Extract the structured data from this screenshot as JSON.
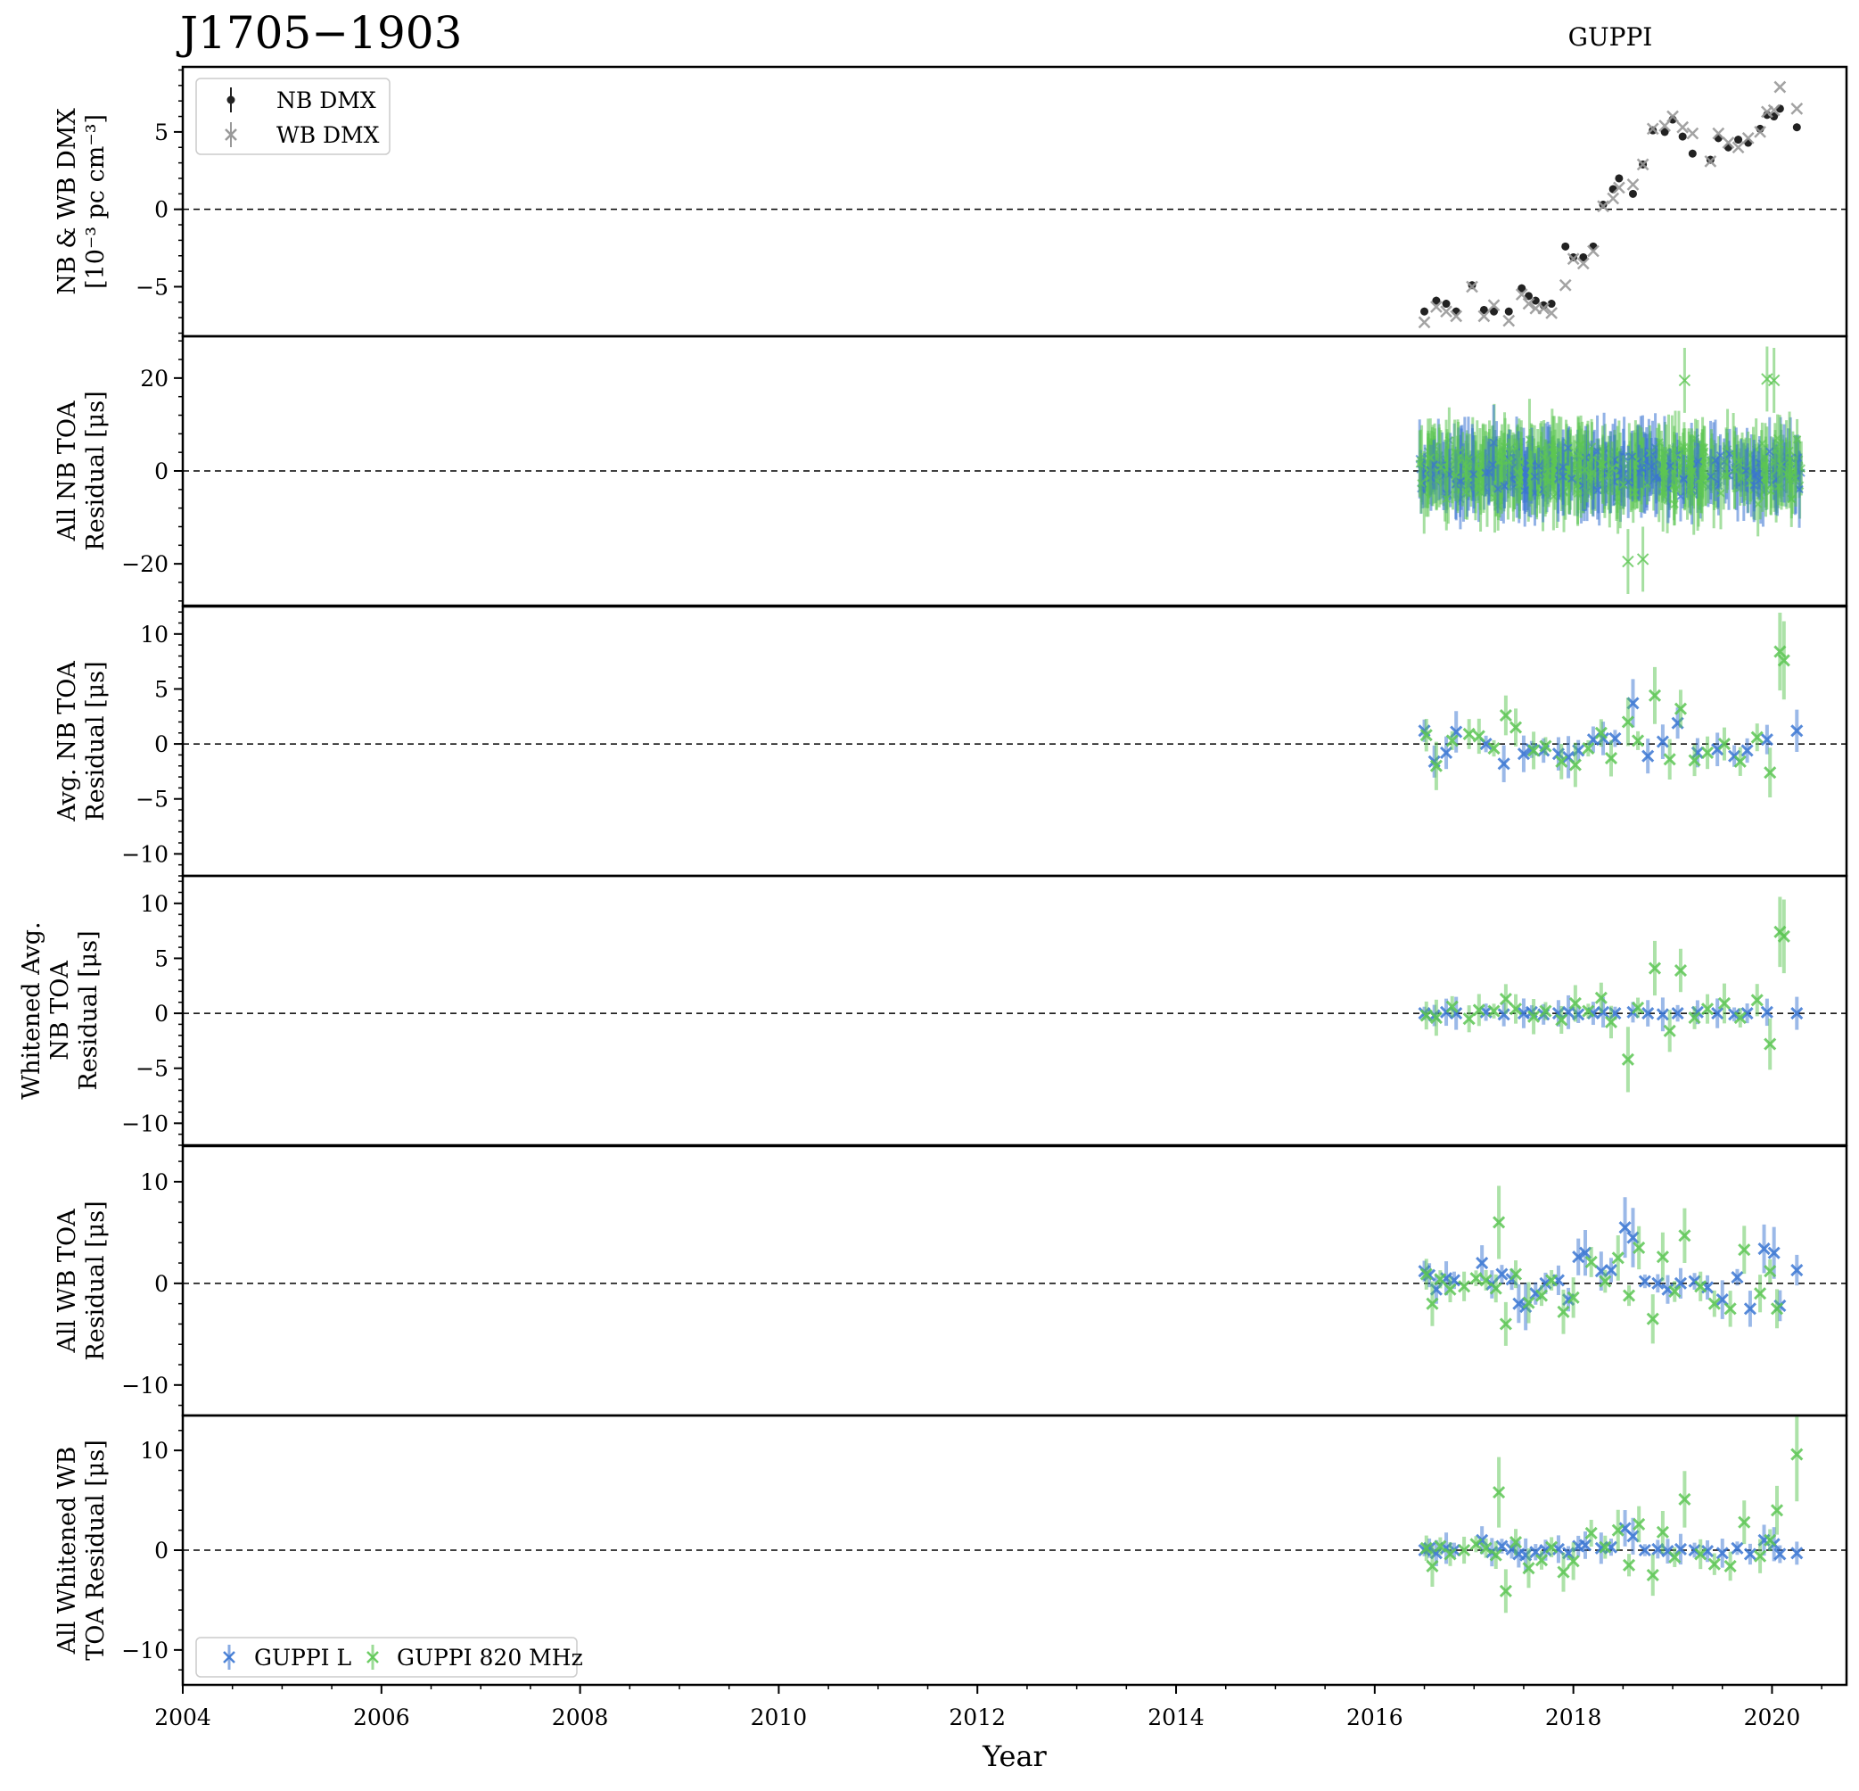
{
  "title": "J1705−1903",
  "subtitle": "GUPPI",
  "colors": {
    "nb_dmx": "#222222",
    "wb_dmx": "#999999",
    "guppi_l": "#3a75d2",
    "guppi_820": "#5cc653"
  },
  "chart_data": {
    "type": "scatter",
    "xlabel": "Year",
    "xlim": [
      2004,
      2020.75
    ],
    "xticks": [
      "2004",
      "2006",
      "2008",
      "2010",
      "2012",
      "2014",
      "2016",
      "2018",
      "2020"
    ],
    "panels": [
      {
        "id": "dmx",
        "ylabel_lines": [
          "NB & WB DMX",
          "[10⁻³ pc cm⁻³]"
        ],
        "ylim": [
          -8.2,
          9.2
        ],
        "yticks": [
          "−5",
          "0",
          "5"
        ],
        "ytick_values": [
          -5,
          0,
          5
        ],
        "legend": {
          "position": "top-left",
          "entries": [
            "NB DMX",
            "WB DMX"
          ]
        },
        "series": [
          {
            "name": "NB DMX",
            "marker": "dot",
            "color": "#222222",
            "x": [
              2016.5,
              2016.62,
              2016.72,
              2016.82,
              2016.98,
              2017.1,
              2017.2,
              2017.35,
              2017.48,
              2017.55,
              2017.62,
              2017.7,
              2017.78,
              2017.92,
              2018.0,
              2018.1,
              2018.2,
              2018.3,
              2018.4,
              2018.46,
              2018.6,
              2018.7,
              2018.8,
              2018.92,
              2019.0,
              2019.1,
              2019.2,
              2019.38,
              2019.46,
              2019.56,
              2019.66,
              2019.76,
              2019.88,
              2019.95,
              2020.02,
              2020.08,
              2020.25
            ],
            "y": [
              -6.6,
              -5.9,
              -6.1,
              -6.6,
              -4.9,
              -6.5,
              -6.6,
              -6.6,
              -5.1,
              -5.6,
              -5.9,
              -6.2,
              -6.1,
              -2.4,
              -3.1,
              -3.1,
              -2.4,
              0.3,
              1.3,
              2.0,
              1.0,
              2.9,
              5.1,
              5.0,
              5.8,
              4.7,
              3.6,
              3.2,
              4.6,
              4.0,
              4.5,
              4.3,
              5.2,
              6.1,
              6.0,
              6.5,
              5.3
            ]
          },
          {
            "name": "WB DMX",
            "marker": "x",
            "color": "#999999",
            "x": [
              2016.5,
              2016.62,
              2016.72,
              2016.82,
              2016.98,
              2017.1,
              2017.2,
              2017.35,
              2017.48,
              2017.55,
              2017.62,
              2017.7,
              2017.78,
              2017.92,
              2018.0,
              2018.1,
              2018.2,
              2018.3,
              2018.4,
              2018.46,
              2018.6,
              2018.7,
              2018.8,
              2018.92,
              2019.0,
              2019.1,
              2019.2,
              2019.38,
              2019.46,
              2019.56,
              2019.66,
              2019.76,
              2019.88,
              2019.95,
              2020.02,
              2020.08,
              2020.25
            ],
            "y": [
              -7.3,
              -6.3,
              -6.6,
              -6.9,
              -5.0,
              -6.9,
              -6.2,
              -7.2,
              -5.5,
              -6.1,
              -6.4,
              -6.4,
              -6.7,
              -4.9,
              -3.2,
              -3.5,
              -2.7,
              0.2,
              0.7,
              1.4,
              1.6,
              2.9,
              5.2,
              5.4,
              6.0,
              5.3,
              4.9,
              3.1,
              4.9,
              4.3,
              4.0,
              4.6,
              5.0,
              6.3,
              6.4,
              7.9,
              6.5
            ]
          }
        ]
      },
      {
        "id": "all_nb",
        "ylabel_lines": [
          "All NB TOA",
          "Residual [μs]"
        ],
        "ylim": [
          -29,
          29
        ],
        "yticks": [
          "−20",
          "0",
          "20"
        ],
        "ytick_values": [
          -20,
          0,
          20
        ],
        "cluster": {
          "x_start": 2016.45,
          "x_end": 2020.3,
          "spread": 5,
          "err": 6,
          "extremes": [
            [
              2018.55,
              -19.5
            ],
            [
              2019.12,
              19.5
            ],
            [
              2019.95,
              19.8
            ],
            [
              2020.02,
              19.5
            ],
            [
              2018.7,
              -19.0
            ]
          ]
        }
      },
      {
        "id": "avg_nb",
        "ylabel_lines": [
          "Avg. NB TOA",
          "Residual [μs]"
        ],
        "ylim": [
          -12,
          12.5
        ],
        "yticks": [
          "−10",
          "−5",
          "0",
          "5",
          "10"
        ],
        "ytick_values": [
          -10,
          -5,
          0,
          5,
          10
        ],
        "series": [
          {
            "name": "GUPPI L",
            "color": "#3a75d2",
            "x": [
              2016.5,
              2016.6,
              2016.72,
              2016.82,
              2017.12,
              2017.3,
              2017.5,
              2017.58,
              2017.7,
              2017.85,
              2017.95,
              2018.05,
              2018.2,
              2018.3,
              2018.42,
              2018.6,
              2018.75,
              2018.9,
              2019.05,
              2019.25,
              2019.45,
              2019.62,
              2019.75,
              2019.95,
              2020.25
            ],
            "y": [
              1.2,
              -1.6,
              -0.8,
              1.1,
              0.0,
              -1.8,
              -0.9,
              -0.5,
              -0.6,
              -0.9,
              -1.2,
              -0.6,
              0.4,
              0.5,
              0.5,
              3.7,
              -1.1,
              0.2,
              1.9,
              -0.8,
              -0.5,
              -1.1,
              -0.6,
              0.4,
              1.2
            ]
          },
          {
            "name": "GUPPI 820 MHz",
            "color": "#5cc653",
            "x": [
              2016.52,
              2016.62,
              2016.78,
              2016.95,
              2017.05,
              2017.2,
              2017.32,
              2017.42,
              2017.6,
              2017.72,
              2017.88,
              2018.02,
              2018.15,
              2018.28,
              2018.38,
              2018.55,
              2018.65,
              2018.82,
              2018.97,
              2019.08,
              2019.22,
              2019.35,
              2019.52,
              2019.68,
              2019.85,
              2019.98,
              2020.08,
              2020.12
            ],
            "y": [
              0.8,
              -2.0,
              0.3,
              0.9,
              0.7,
              -0.4,
              2.6,
              1.5,
              -0.6,
              -0.2,
              -1.6,
              -1.9,
              -0.4,
              1.0,
              -1.3,
              2.0,
              0.3,
              4.4,
              -1.4,
              3.2,
              -1.5,
              -0.8,
              0.0,
              -1.6,
              0.6,
              -2.6,
              8.4,
              7.6
            ]
          }
        ]
      },
      {
        "id": "white_avg_nb",
        "ylabel_lines": [
          "Whitened Avg.",
          "NB TOA",
          "Residual [μs]"
        ],
        "ylim": [
          -12,
          12.5
        ],
        "yticks": [
          "−10",
          "−5",
          "0",
          "5",
          "10"
        ],
        "ytick_values": [
          -10,
          -5,
          0,
          5,
          10
        ],
        "series": [
          {
            "name": "GUPPI L",
            "color": "#3a75d2",
            "x": [
              2016.5,
              2016.6,
              2016.72,
              2016.82,
              2017.12,
              2017.3,
              2017.5,
              2017.58,
              2017.7,
              2017.85,
              2017.95,
              2018.05,
              2018.2,
              2018.3,
              2018.42,
              2018.6,
              2018.75,
              2018.9,
              2019.05,
              2019.25,
              2019.45,
              2019.62,
              2019.75,
              2019.95,
              2020.25
            ],
            "y": [
              0.0,
              -0.2,
              0.1,
              0.0,
              0.1,
              -0.1,
              0.0,
              0.1,
              -0.1,
              0.0,
              0.1,
              -0.1,
              0.0,
              0.1,
              0.0,
              0.1,
              0.0,
              -0.1,
              0.0,
              0.1,
              0.0,
              -0.1,
              0.0,
              0.1,
              0.0
            ]
          },
          {
            "name": "GUPPI 820 MHz",
            "color": "#5cc653",
            "x": [
              2016.52,
              2016.62,
              2016.78,
              2016.95,
              2017.05,
              2017.2,
              2017.32,
              2017.42,
              2017.6,
              2017.72,
              2017.88,
              2018.02,
              2018.15,
              2018.28,
              2018.38,
              2018.55,
              2018.65,
              2018.82,
              2018.97,
              2019.08,
              2019.22,
              2019.35,
              2019.52,
              2019.68,
              2019.85,
              2019.98,
              2020.08,
              2020.12
            ],
            "y": [
              -0.2,
              -0.4,
              0.6,
              -0.5,
              0.3,
              0.2,
              1.3,
              0.4,
              -0.3,
              0.2,
              -0.6,
              0.9,
              0.2,
              1.4,
              -0.8,
              -4.2,
              0.5,
              4.1,
              -1.6,
              3.9,
              -0.4,
              0.4,
              0.9,
              -0.4,
              1.2,
              -2.8,
              7.4,
              7.0
            ]
          }
        ]
      },
      {
        "id": "all_wb",
        "ylabel_lines": [
          "All WB TOA",
          "Residual [μs]"
        ],
        "ylim": [
          -13,
          13.5
        ],
        "yticks": [
          "−10",
          "0",
          "10"
        ],
        "ytick_values": [
          -10,
          0,
          10
        ],
        "series": [
          {
            "name": "GUPPI L",
            "color": "#3a75d2",
            "x": [
              2016.5,
              2016.55,
              2016.62,
              2016.72,
              2016.8,
              2017.08,
              2017.18,
              2017.28,
              2017.38,
              2017.45,
              2017.52,
              2017.62,
              2017.72,
              2017.85,
              2017.95,
              2018.05,
              2018.12,
              2018.28,
              2018.38,
              2018.52,
              2018.6,
              2018.72,
              2018.85,
              2018.95,
              2019.08,
              2019.22,
              2019.35,
              2019.5,
              2019.65,
              2019.78,
              2019.92,
              2020.02,
              2020.08,
              2020.25
            ],
            "y": [
              1.2,
              0.8,
              -0.6,
              0.5,
              0.3,
              2.0,
              -0.1,
              0.9,
              0.4,
              -2.0,
              -2.3,
              -1.0,
              0.0,
              0.3,
              -1.6,
              2.6,
              3.0,
              1.2,
              1.3,
              5.5,
              4.5,
              0.2,
              0.0,
              -0.6,
              0.0,
              0.2,
              -0.4,
              -1.6,
              0.6,
              -2.5,
              3.4,
              3.0,
              -2.2,
              1.3
            ]
          },
          {
            "name": "GUPPI 820 MHz",
            "color": "#5cc653",
            "x": [
              2016.52,
              2016.58,
              2016.66,
              2016.76,
              2016.9,
              2017.02,
              2017.12,
              2017.22,
              2017.25,
              2017.32,
              2017.42,
              2017.55,
              2017.68,
              2017.78,
              2017.9,
              2018.0,
              2018.18,
              2018.32,
              2018.45,
              2018.56,
              2018.66,
              2018.8,
              2018.9,
              2019.02,
              2019.12,
              2019.28,
              2019.42,
              2019.58,
              2019.72,
              2019.88,
              2019.98,
              2020.05
            ],
            "y": [
              0.9,
              -2.0,
              0.4,
              -0.6,
              -0.3,
              0.5,
              0.3,
              -0.5,
              6.0,
              -4.0,
              0.9,
              -1.9,
              -1.2,
              0.3,
              -2.8,
              -1.4,
              2.1,
              0.2,
              2.5,
              -1.2,
              3.5,
              -3.5,
              2.6,
              -0.8,
              4.7,
              -0.3,
              -2.0,
              -2.5,
              3.3,
              -1.0,
              1.2,
              -2.5
            ]
          }
        ]
      },
      {
        "id": "white_wb",
        "ylabel_lines": [
          "All Whitened WB",
          "TOA Residual [μs]"
        ],
        "ylim": [
          -13.5,
          13.5
        ],
        "yticks": [
          "−10",
          "0",
          "10"
        ],
        "ytick_values": [
          -10,
          0,
          10
        ],
        "legend": {
          "position": "bottom-left",
          "entries": [
            "GUPPI L",
            "GUPPI 820 MHz"
          ]
        },
        "series": [
          {
            "name": "GUPPI L",
            "color": "#3a75d2",
            "x": [
              2016.5,
              2016.55,
              2016.62,
              2016.72,
              2016.8,
              2017.08,
              2017.18,
              2017.28,
              2017.38,
              2017.45,
              2017.52,
              2017.62,
              2017.72,
              2017.85,
              2017.95,
              2018.05,
              2018.12,
              2018.28,
              2018.38,
              2018.52,
              2018.6,
              2018.72,
              2018.85,
              2018.95,
              2019.08,
              2019.22,
              2019.35,
              2019.5,
              2019.65,
              2019.78,
              2019.92,
              2020.02,
              2020.08,
              2020.25
            ],
            "y": [
              0.0,
              0.2,
              -0.3,
              0.2,
              0.0,
              1.0,
              -0.2,
              0.4,
              0.1,
              -0.4,
              -0.5,
              -0.2,
              0.0,
              0.1,
              -0.3,
              0.4,
              0.5,
              0.2,
              0.3,
              2.2,
              1.4,
              0.0,
              0.1,
              -0.1,
              0.1,
              0.0,
              -0.1,
              -0.3,
              0.2,
              -0.4,
              1.0,
              0.6,
              -0.4,
              -0.3
            ]
          },
          {
            "name": "GUPPI 820 MHz",
            "color": "#5cc653",
            "x": [
              2016.52,
              2016.58,
              2016.66,
              2016.76,
              2016.9,
              2017.02,
              2017.12,
              2017.22,
              2017.25,
              2017.32,
              2017.42,
              2017.55,
              2017.68,
              2017.78,
              2017.9,
              2018.0,
              2018.18,
              2018.32,
              2018.45,
              2018.56,
              2018.66,
              2018.8,
              2018.9,
              2019.02,
              2019.12,
              2019.28,
              2019.42,
              2019.58,
              2019.72,
              2019.88,
              2019.98,
              2020.05,
              2020.25
            ],
            "y": [
              0.2,
              -1.6,
              0.4,
              -0.4,
              0.0,
              0.6,
              0.2,
              -0.5,
              5.8,
              -4.1,
              0.8,
              -1.8,
              -1.0,
              0.3,
              -2.2,
              -1.1,
              1.7,
              0.3,
              2.0,
              -1.5,
              2.6,
              -2.5,
              1.8,
              -0.7,
              5.1,
              -0.4,
              -1.4,
              -1.6,
              2.8,
              -0.6,
              1.0,
              4.0,
              9.6
            ]
          }
        ]
      }
    ]
  }
}
